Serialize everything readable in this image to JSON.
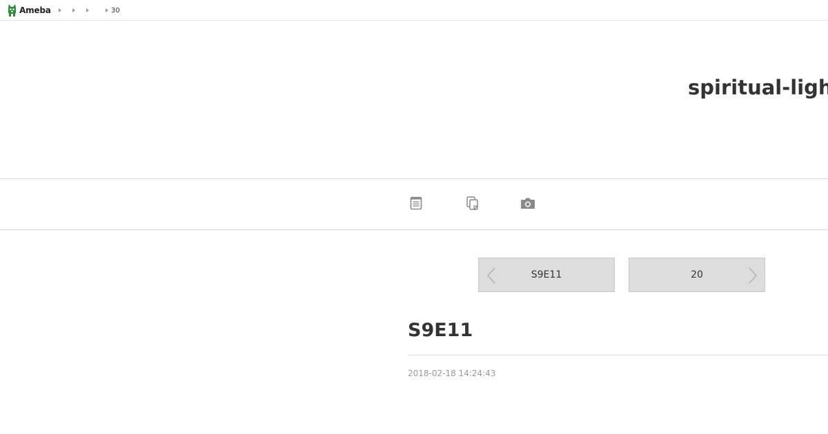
{
  "header": {
    "logo_text": "Ameba",
    "logo_color": "#2d8c3c",
    "breadcrumb": [
      "",
      "",
      "",
      "30"
    ]
  },
  "blog": {
    "title": "spiritual-light"
  },
  "nav": {
    "icons": [
      "entry-list-icon",
      "theme-list-icon",
      "photo-icon"
    ]
  },
  "pager": {
    "prev_label": "S9E11",
    "next_label": "20"
  },
  "entry": {
    "title": "S9E11",
    "date": "2018-02-18 14:24:43"
  }
}
